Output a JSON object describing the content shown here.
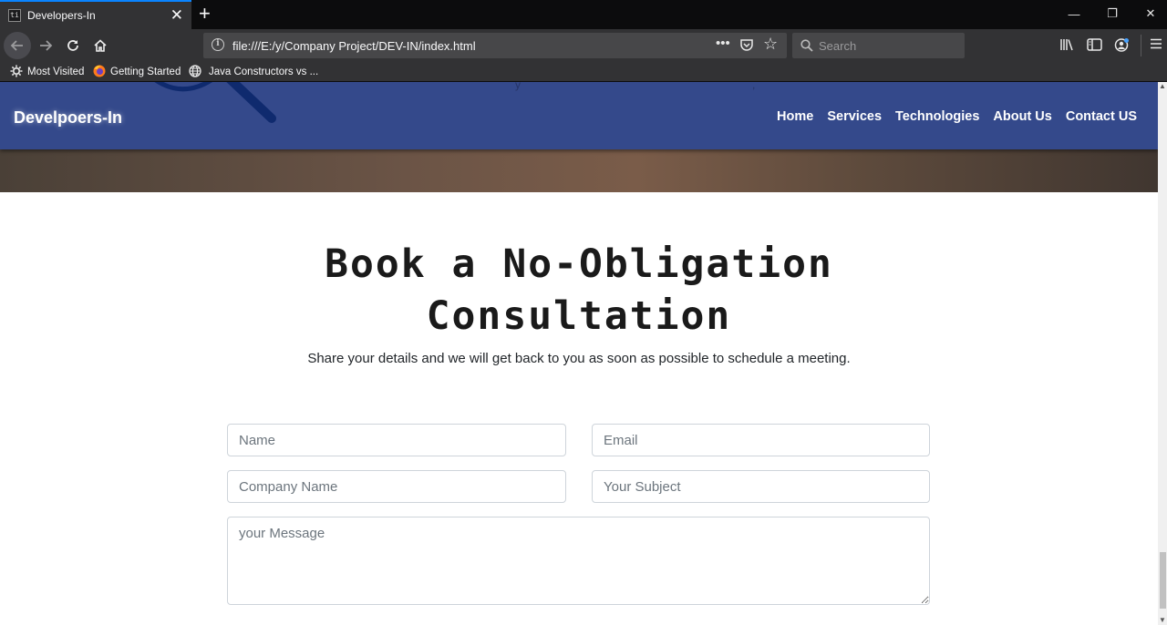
{
  "browser": {
    "tab_title": "Developers-In",
    "tab_favicon_text": "ti",
    "url": "file:///E:/y/Company Project/DEV-IN/index.html",
    "search_placeholder": "Search",
    "bookmarks": [
      {
        "label": "Most Visited",
        "icon": "gear-icon"
      },
      {
        "label": "Getting Started",
        "icon": "firefox-icon"
      },
      {
        "label": "Java Constructors vs ...",
        "icon": "globe-icon"
      }
    ]
  },
  "site": {
    "brand": "Develpoers-In",
    "nav": [
      "Home",
      "Services",
      "Technologies",
      "About Us",
      "Contact US"
    ],
    "hero_faint_text": [
      "y",
      ","
    ]
  },
  "consultation": {
    "title_line1": "Book a No-Obligation",
    "title_line2": "Consultation",
    "subtitle": "Share your details and we will get back to you as soon as possible to schedule a meeting.",
    "form": {
      "name_placeholder": "Name",
      "email_placeholder": "Email",
      "company_placeholder": "Company Name",
      "subject_placeholder": "Your Subject",
      "message_placeholder": "your Message"
    }
  },
  "colors": {
    "nav_bg": "#34498b",
    "accent_tab": "#0a84ff",
    "chrome_bg": "#323234"
  }
}
